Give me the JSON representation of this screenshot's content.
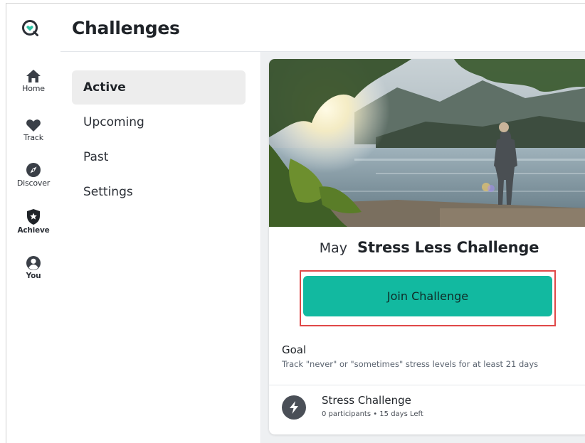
{
  "nav": {
    "items": [
      {
        "label": "Home",
        "icon": "home-icon"
      },
      {
        "label": "Track",
        "icon": "heart-icon"
      },
      {
        "label": "Discover",
        "icon": "compass-icon"
      },
      {
        "label": "Achieve",
        "icon": "star-shield-icon"
      },
      {
        "label": "You",
        "icon": "user-icon"
      }
    ]
  },
  "header": {
    "title": "Challenges"
  },
  "submenu": {
    "items": [
      {
        "label": "Active",
        "active": true
      },
      {
        "label": "Upcoming"
      },
      {
        "label": "Past"
      },
      {
        "label": "Settings"
      }
    ]
  },
  "challenge": {
    "month": "May",
    "name": "Stress Less Challenge",
    "join_label": "Join Challenge",
    "goal_title": "Goal",
    "goal_text": "Track \"never\" or \"sometimes\" stress levels for at least 21 days",
    "stat_title": "Stress Challenge",
    "stat_meta": "0 participants  •  15 days Left"
  },
  "colors": {
    "accent": "#12b9a0",
    "highlight_border": "#e04848",
    "logo_teal": "#2ec4a6"
  }
}
